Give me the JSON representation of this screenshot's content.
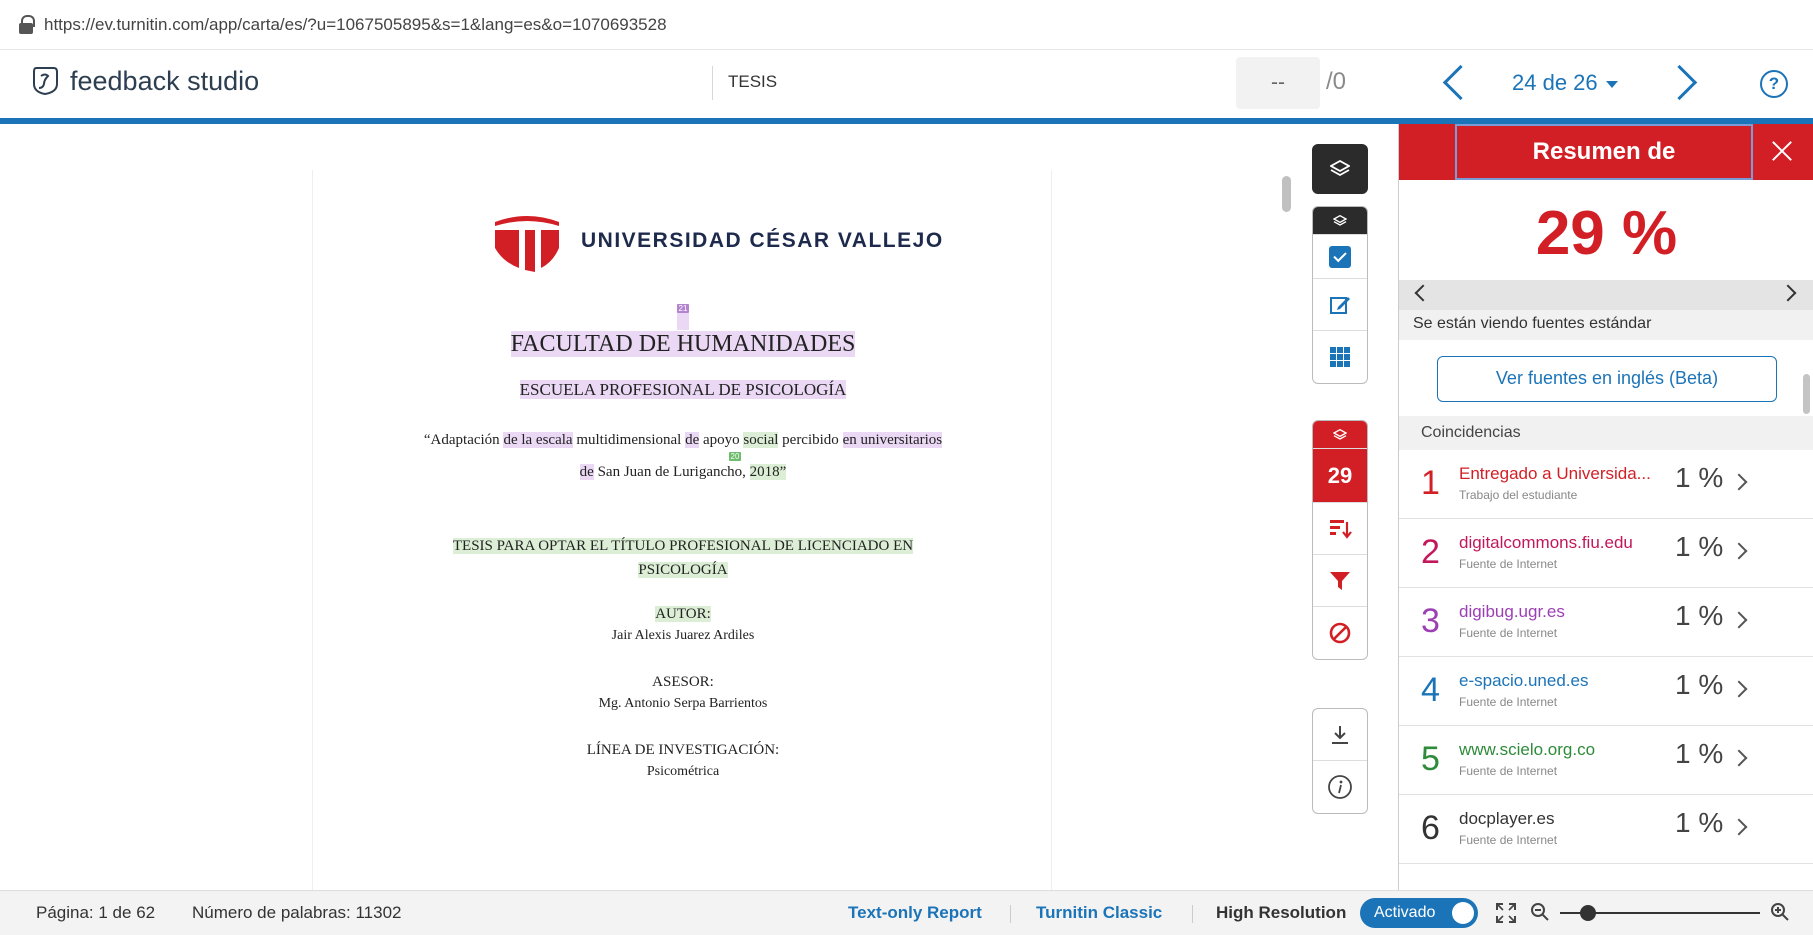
{
  "browser": {
    "url": "https://ev.turnitin.com/app/carta/es/?u=1067505895&s=1&lang=es&o=1070693528"
  },
  "header": {
    "logo_text": "feedback studio",
    "doc_title": "TESIS",
    "page_input_value": "--",
    "page_total": "/0",
    "page_select": "24 de 26"
  },
  "document": {
    "university": "UNIVERSIDAD CÉSAR VALLEJO",
    "mark_faculty": "21",
    "faculty": "FACULTAD DE HUMANIDADES",
    "school": "ESCUELA PROFESIONAL DE PSICOLOGÍA",
    "title_line1_a": "“Adaptación ",
    "title_line1_b": "de la escala",
    "title_line1_c": " multidimensional ",
    "title_line1_d": "de",
    "title_line1_e": " apoyo ",
    "title_line1_f": "social",
    "title_line1_g": " percibido ",
    "title_line1_h": "en universitarios",
    "mark_title": "20",
    "title_line2_a": "de",
    "title_line2_b": " San Juan de Lurigancho, ",
    "title_line2_c": "2018”",
    "tesis_line1": "TESIS PARA OPTAR EL TÍTULO PROFESIONAL DE LICENCIADO EN",
    "tesis_line2": "PSICOLOGÍA",
    "autor_label": "AUTOR:",
    "autor_name": "Jair Alexis Juarez Ardiles",
    "asesor_label": "ASESOR:",
    "asesor_name": "Mg. Antonio Serpa Barrientos",
    "linea_label": "LÍNEA DE INVESTIGACIÓN:",
    "linea_value": "Psicométrica"
  },
  "toolbar": {
    "match_count": "29"
  },
  "panel": {
    "title": "Resumen de coincidencias",
    "percent": "29 %",
    "standard_sources": "Se están viendo fuentes estándar",
    "english_button": "Ver fuentes en inglés (Beta)",
    "matches_header": "Coincidencias",
    "matches": [
      {
        "num": "1",
        "name": "Entregado a Universida...",
        "type": "Trabajo del estudiante",
        "pct": "1 %",
        "color": "#d21f26"
      },
      {
        "num": "2",
        "name": "digitalcommons.fiu.edu",
        "type": "Fuente de Internet",
        "pct": "1 %",
        "color": "#c2185b"
      },
      {
        "num": "3",
        "name": "digibug.ugr.es",
        "type": "Fuente de Internet",
        "pct": "1 %",
        "color": "#9c3fb5"
      },
      {
        "num": "4",
        "name": "e-spacio.uned.es",
        "type": "Fuente de Internet",
        "pct": "1 %",
        "color": "#1c74b8"
      },
      {
        "num": "5",
        "name": "www.scielo.org.co",
        "type": "Fuente de Internet",
        "pct": "1 %",
        "color": "#2e8b3a"
      },
      {
        "num": "6",
        "name": "docplayer.es",
        "type": "Fuente de Internet",
        "pct": "1 %",
        "color": "#333333"
      }
    ]
  },
  "status": {
    "page": "Página: 1 de 62",
    "words": "Número de palabras: 11302",
    "text_only": "Text-only Report",
    "classic": "Turnitin Classic",
    "high_res": "High Resolution",
    "toggle_label": "Activado"
  },
  "colors": {
    "accent_blue": "#1c74b8",
    "turnitin_red": "#d21f26",
    "dark": "#2b2b2b"
  }
}
